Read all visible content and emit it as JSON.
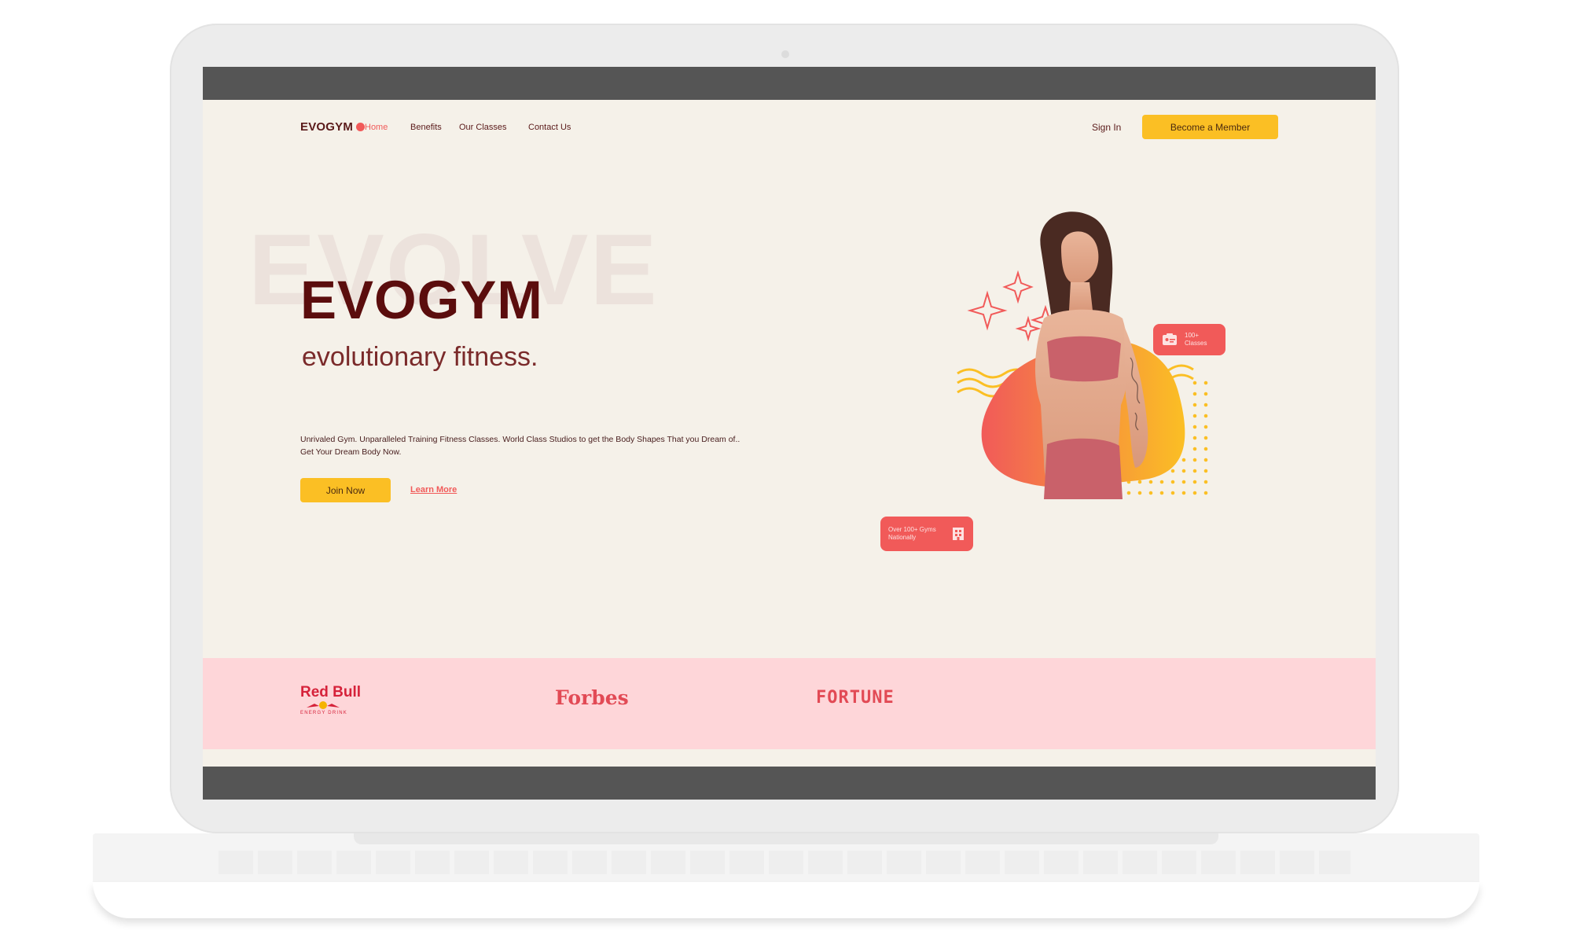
{
  "nav": {
    "logo": "EVOGYM",
    "links": [
      "Home",
      "Benefits",
      "Our Classes",
      "Contact Us"
    ],
    "active": "Home",
    "sign_in": "Sign In",
    "cta": "Become a Member"
  },
  "hero": {
    "background_word": "EVOLVE",
    "title": "EVOGYM",
    "subtitle": "evolutionary fitness.",
    "description": "Unrivaled Gym. Unparalleled Training Fitness Classes. World Class Studios to get the Body Shapes That you Dream of.. Get Your Dream Body Now.",
    "join_button": "Join Now",
    "learn_more": "Learn More",
    "badge_classes": "100+ Classes",
    "badge_gyms": "Over 100+ Gyms Nationally"
  },
  "sponsors": {
    "redbull": "Red Bull",
    "redbull_sub": "ENERGY DRINK",
    "forbes": "Forbes",
    "fortune": "FORTUNE"
  },
  "colors": {
    "primary": "#f15a59",
    "secondary": "#fbbf24",
    "background": "#f5f1e9",
    "sponsor_band": "#fed6d9",
    "heading": "#5b0d0d"
  }
}
